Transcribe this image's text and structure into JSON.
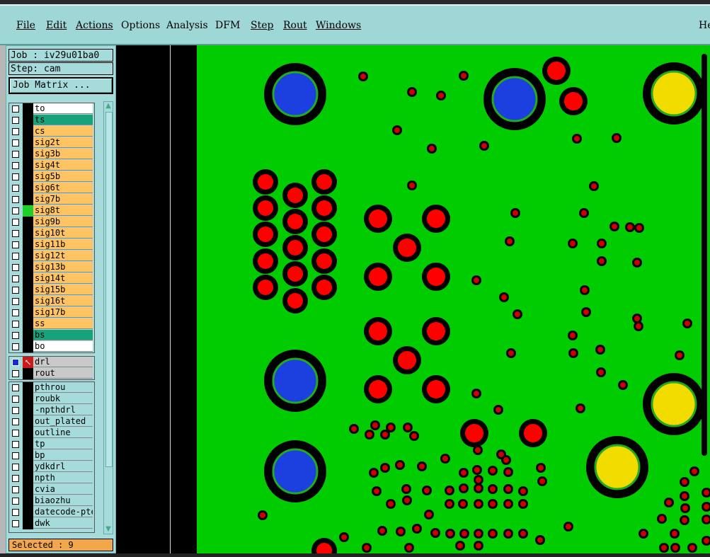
{
  "menu": {
    "file": "File",
    "edit": "Edit",
    "actions": "Actions",
    "options": "Options",
    "analysis": "Analysis",
    "dfm": "DFM",
    "step": "Step",
    "rout": "Rout",
    "windows": "Windows",
    "help": "He"
  },
  "info": {
    "job": "Job : iv29u01ba0",
    "step": "Step: cam",
    "job_matrix": "Job Matrix ..."
  },
  "layers_board": [
    {
      "name": "to",
      "color": "white"
    },
    {
      "name": "ts",
      "color": "teal"
    },
    {
      "name": "cs",
      "color": "orange"
    },
    {
      "name": "sig2t",
      "color": "orange"
    },
    {
      "name": "sig3b",
      "color": "orange"
    },
    {
      "name": "sig4t",
      "color": "orange"
    },
    {
      "name": "sig5b",
      "color": "orange"
    },
    {
      "name": "sig6t",
      "color": "orange"
    },
    {
      "name": "sig7b",
      "color": "orange"
    },
    {
      "name": "sig8t",
      "color": "orange",
      "marker": "green"
    },
    {
      "name": "sig9b",
      "color": "orange"
    },
    {
      "name": "sig10t",
      "color": "orange"
    },
    {
      "name": "sig11b",
      "color": "orange"
    },
    {
      "name": "sig12t",
      "color": "orange"
    },
    {
      "name": "sig13b",
      "color": "orange"
    },
    {
      "name": "sig14t",
      "color": "orange"
    },
    {
      "name": "sig15b",
      "color": "orange"
    },
    {
      "name": "sig16t",
      "color": "orange"
    },
    {
      "name": "sig17b",
      "color": "orange"
    },
    {
      "name": "ss",
      "color": "orange"
    },
    {
      "name": "bs",
      "color": "teal"
    },
    {
      "name": "bo",
      "color": "white"
    }
  ],
  "layers_drill": [
    {
      "name": "drl",
      "color": "gray",
      "active": true
    },
    {
      "name": "rout",
      "color": "gray"
    }
  ],
  "layers_misc": [
    {
      "name": "pthrou",
      "color": "cyan"
    },
    {
      "name": "roubk",
      "color": "cyan"
    },
    {
      "name": "-npthdrl",
      "color": "cyan"
    },
    {
      "name": "out_plated",
      "color": "cyan"
    },
    {
      "name": "outline",
      "color": "cyan"
    },
    {
      "name": "tp",
      "color": "cyan"
    },
    {
      "name": "bp",
      "color": "cyan"
    },
    {
      "name": "ydkdrl",
      "color": "cyan"
    },
    {
      "name": "npth",
      "color": "cyan"
    },
    {
      "name": "cvia",
      "color": "cyan"
    },
    {
      "name": "biaozhu",
      "color": "cyan"
    },
    {
      "name": "datecode-pte",
      "color": "cyan"
    },
    {
      "name": "dwk",
      "color": "cyan"
    }
  ],
  "status": {
    "selected": "Selected : 9"
  },
  "colors": {
    "board": "#00cc00",
    "pad_red": "#ff0000",
    "pad_blue": "#1c3fe0",
    "pad_yellow": "#f2dc00",
    "ring_black": "#000000",
    "ring_green": "#22aa22",
    "small_pad": "#cc0000"
  }
}
